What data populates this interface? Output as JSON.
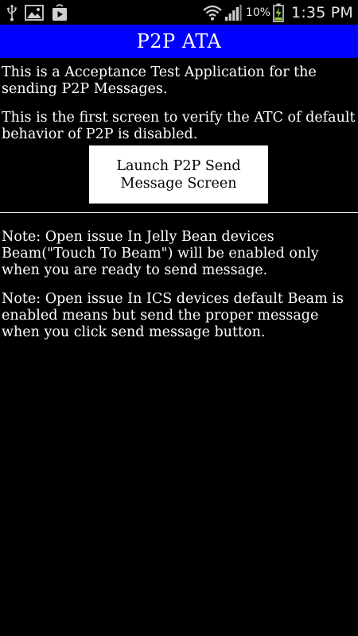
{
  "status_bar": {
    "left_icons": [
      "usb-icon",
      "image-icon",
      "play-store-icon"
    ],
    "right_icons": [
      "wifi-icon",
      "signal-icon",
      "battery-charging-icon"
    ],
    "battery_percent": "10%",
    "time": "1:35 PM"
  },
  "header": {
    "title": "P2P ATA",
    "background_color": "#0000ff"
  },
  "main": {
    "intro_text": "This is a Acceptance Test Application for the sending P2P Messages.",
    "screen_text": "This is the first screen to verify the ATC of default behavior of P2P is disabled.",
    "launch_button_label": "Launch P2P Send Message Screen",
    "note_jelly_bean": "Note: Open issue In Jelly Bean devices Beam(\"Touch To Beam\") will be enabled only when you are ready to send message.",
    "note_ics": "Note: Open issue In ICS devices default Beam is enabled means but send the proper message when you click send message button."
  }
}
